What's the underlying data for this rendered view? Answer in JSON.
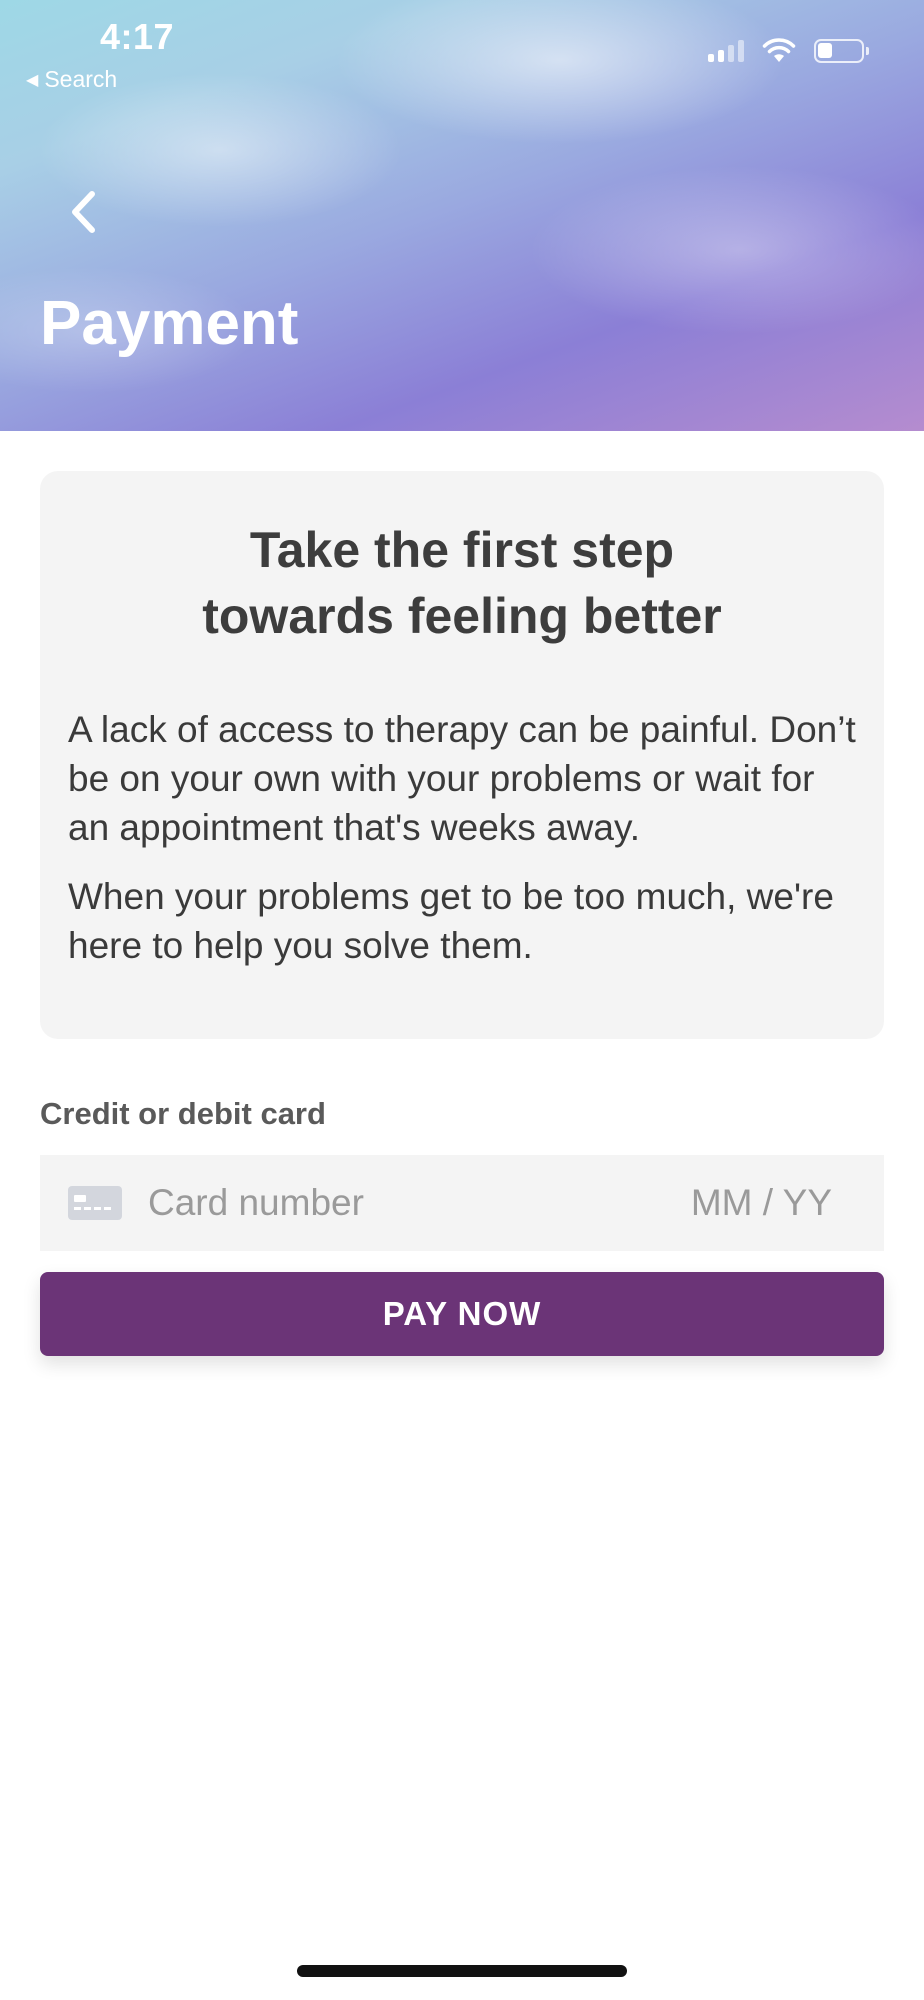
{
  "status_bar": {
    "time": "4:17",
    "back_app_label": "Search",
    "battery_level_percent": 35
  },
  "header": {
    "title": "Payment"
  },
  "info_card": {
    "headline_line1": "Take the first step",
    "headline_line2": "towards feeling better",
    "paragraph1": "A lack of access to therapy can be painful. Don’t be on your own with your problems or wait for an appointment that's weeks away.",
    "paragraph2": "When your problems get to be too much, we're here to help you solve them."
  },
  "payment_form": {
    "card_label": "Credit or debit card",
    "card_number_placeholder": "Card number",
    "expiry_placeholder": "MM / YY",
    "pay_button_label": "PAY NOW"
  },
  "colors": {
    "pay_button": "#6b3477",
    "card_background": "#f4f4f4",
    "header_gradient_top": "#9ed8e6",
    "header_gradient_bottom": "#8b7fd6"
  }
}
